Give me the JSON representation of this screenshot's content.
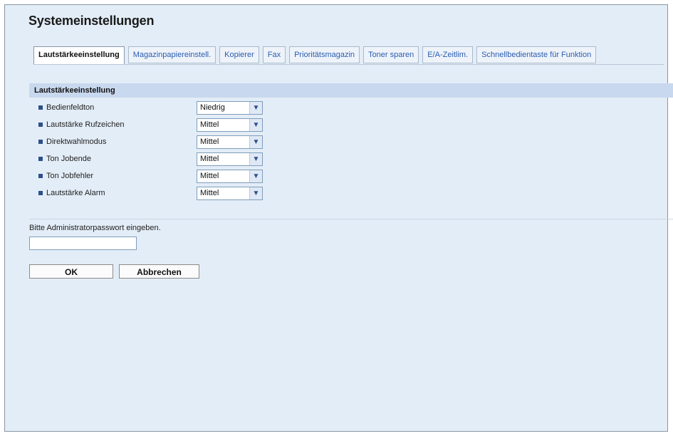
{
  "page": {
    "title": "Systemeinstellungen"
  },
  "tabs": [
    {
      "label": "Lautstärkeeinstellung",
      "active": true
    },
    {
      "label": "Magazinpapiereinstell.",
      "active": false
    },
    {
      "label": "Kopierer",
      "active": false
    },
    {
      "label": "Fax",
      "active": false
    },
    {
      "label": "Prioritätsmagazin",
      "active": false
    },
    {
      "label": "Toner sparen",
      "active": false
    },
    {
      "label": "E/A-Zeitlim.",
      "active": false
    },
    {
      "label": "Schnellbedientaste für Funktion",
      "active": false
    }
  ],
  "section": {
    "title": "Lautstärkeeinstellung"
  },
  "settings": [
    {
      "label": "Bedienfeldton",
      "value": "Niedrig"
    },
    {
      "label": "Lautstärke Rufzeichen",
      "value": "Mittel"
    },
    {
      "label": "Direktwahlmodus",
      "value": "Mittel"
    },
    {
      "label": "Ton Jobende",
      "value": "Mittel"
    },
    {
      "label": "Ton Jobfehler",
      "value": "Mittel"
    },
    {
      "label": "Lautstärke Alarm",
      "value": "Mittel"
    }
  ],
  "password": {
    "prompt": "Bitte Administratorpasswort eingeben.",
    "value": ""
  },
  "buttons": {
    "ok": "OK",
    "cancel": "Abbrechen"
  },
  "icons": {
    "bullet": "square-bullet-icon",
    "dropdown": "chevron-down-icon"
  },
  "colors": {
    "background": "#e3edf7",
    "section_header": "#c8d8ee",
    "tab_link": "#2a5db0",
    "bullet": "#2d4f8a"
  }
}
